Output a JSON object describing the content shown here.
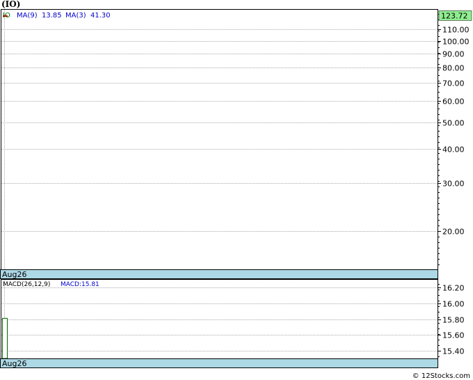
{
  "title": "(IO)",
  "credit": "© 12Stocks.com",
  "colors": {
    "ticker": "#006400",
    "indicator": "#0000cc",
    "grid": "#aaaaaa",
    "date_bar": "#add8e6",
    "last_price_bg": "#90ee90",
    "candle_up": "#006400",
    "candle_down": "#cc0000",
    "border": "#000000"
  },
  "chart_data": [
    {
      "type": "candlestick",
      "name": "price",
      "ticker": "IO",
      "indicators": [
        {
          "label": "MA(9)",
          "value": "13.85"
        },
        {
          "label": "MA(3)",
          "value": "41.30"
        }
      ],
      "y_scale": "log",
      "ylim": [
        14.5,
        130
      ],
      "y_ticks": [
        20,
        30,
        40,
        50,
        60,
        70,
        80,
        90,
        100,
        110
      ],
      "y_tick_labels": [
        "20.00",
        "30.00",
        "40.00",
        "50.00",
        "60.00",
        "70.00",
        "80.00",
        "90.00",
        "100.00",
        "110.00"
      ],
      "last_price": 123.72,
      "last_price_label": "123.72",
      "x_label": "Aug26",
      "grid": true,
      "candles": [
        {
          "open": 123.9,
          "high": 124.4,
          "low": 123.2,
          "close": 123.5
        }
      ]
    },
    {
      "type": "bar",
      "name": "macd",
      "indicator_label": "MACD(26,12,9)",
      "indicator_value_label": "MACD:15.81",
      "ylim": [
        15.3,
        16.3
      ],
      "y_ticks": [
        15.4,
        15.6,
        15.8,
        16.0,
        16.2
      ],
      "y_tick_labels": [
        "15.40",
        "15.60",
        "15.80",
        "16.00",
        "16.20"
      ],
      "x_label": "Aug26",
      "grid": true,
      "values": [
        15.81
      ]
    }
  ]
}
